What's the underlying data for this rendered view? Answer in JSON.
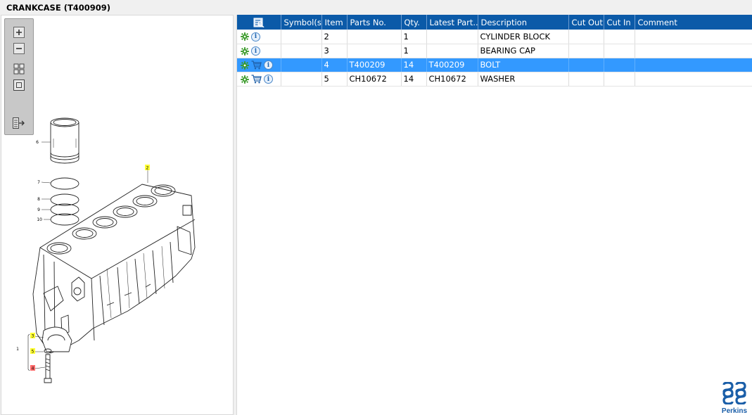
{
  "window": {
    "title": "CRANKCASE (T400909)"
  },
  "toolbox": {
    "buttons": [
      {
        "name": "zoom-in-button",
        "icon": "zoom-in-icon"
      },
      {
        "name": "zoom-out-button",
        "icon": "zoom-out-icon"
      },
      {
        "name": "fit-all-button",
        "icon": "fit-all-icon"
      },
      {
        "name": "actual-size-button",
        "icon": "actual-size-icon"
      },
      {
        "name": "export-list-button",
        "icon": "export-list-icon"
      }
    ]
  },
  "diagram": {
    "callouts": [
      "1",
      "2",
      "3",
      "5",
      "6",
      "7",
      "8",
      "9",
      "10",
      "4"
    ],
    "highlight_color": "#ffff33",
    "alert_color": "#ff6b6b"
  },
  "table": {
    "headers": [
      "Symbol(s)",
      "Item",
      "Parts No.",
      "Qty.",
      "Latest Part...",
      "Description",
      "Cut Out",
      "Cut In",
      "Comment"
    ],
    "rows": [
      {
        "item": "2",
        "parts_no": "",
        "qty": "1",
        "latest_part": "",
        "description": "CYLINDER BLOCK",
        "cut_out": "",
        "cut_in": "",
        "comment": "",
        "cart": false,
        "selected": false
      },
      {
        "item": "3",
        "parts_no": "",
        "qty": "1",
        "latest_part": "",
        "description": "BEARING CAP",
        "cut_out": "",
        "cut_in": "",
        "comment": "",
        "cart": false,
        "selected": false
      },
      {
        "item": "4",
        "parts_no": "T400209",
        "qty": "14",
        "latest_part": "T400209",
        "description": "BOLT",
        "cut_out": "",
        "cut_in": "",
        "comment": "",
        "cart": true,
        "selected": true
      },
      {
        "item": "5",
        "parts_no": "CH10672",
        "qty": "14",
        "latest_part": "CH10672",
        "description": "WASHER",
        "cut_out": "",
        "cut_in": "",
        "comment": "",
        "cart": true,
        "selected": false
      }
    ]
  },
  "branding": {
    "logo_text": "Perkins",
    "logo_color": "#1a5ea8"
  },
  "colors": {
    "header": "#0b5aa8",
    "selected_row": "#3399ff",
    "gear": "#3a9a2a"
  }
}
